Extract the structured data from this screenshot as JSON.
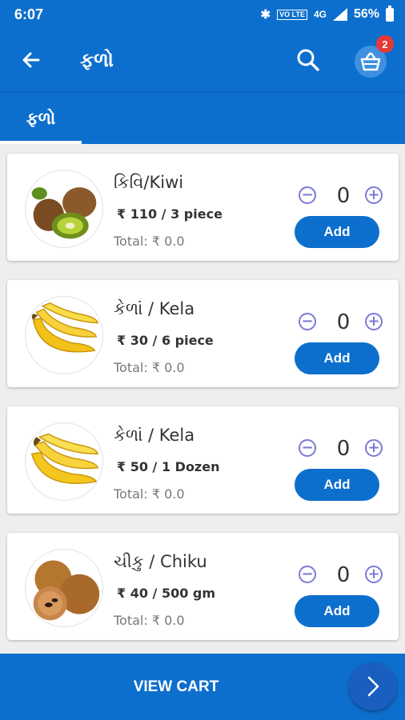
{
  "status_bar": {
    "time": "6:07",
    "volte_label": "VO LTE",
    "network": "4G",
    "battery": "56%"
  },
  "app_bar": {
    "title": "ફળો",
    "cart_badge": "2",
    "icons": [
      "back-arrow-icon",
      "search-icon",
      "cart-basket-icon"
    ]
  },
  "tabs": [
    {
      "label": "ફળો",
      "active": true
    }
  ],
  "products": [
    {
      "name": "કિવિ/Kiwi",
      "price": "₹ 110 / 3 piece",
      "total": "Total: ₹ 0.0",
      "quantity": "0",
      "add_label": "Add",
      "image": "kiwi"
    },
    {
      "name": "કેળાં / Kela",
      "price": "₹ 30 / 6  piece",
      "total": "Total: ₹ 0.0",
      "quantity": "0",
      "add_label": "Add",
      "image": "banana"
    },
    {
      "name": "કેળાં / Kela",
      "price": "₹ 50 / 1 Dozen",
      "total": "Total: ₹ 0.0",
      "quantity": "0",
      "add_label": "Add",
      "image": "banana"
    },
    {
      "name": "ચીકુ / Chiku",
      "price": "₹ 40 / 500 gm",
      "total": "Total: ₹ 0.0",
      "quantity": "0",
      "add_label": "Add",
      "image": "chiku"
    }
  ],
  "qty_controls": {
    "minus": "−",
    "plus": "+"
  },
  "bottom_bar": {
    "view_cart_label": "VIEW CART"
  },
  "colors": {
    "primary": "#0d6fcd",
    "badge": "#e53935",
    "stepper": "#7b7bd6"
  }
}
